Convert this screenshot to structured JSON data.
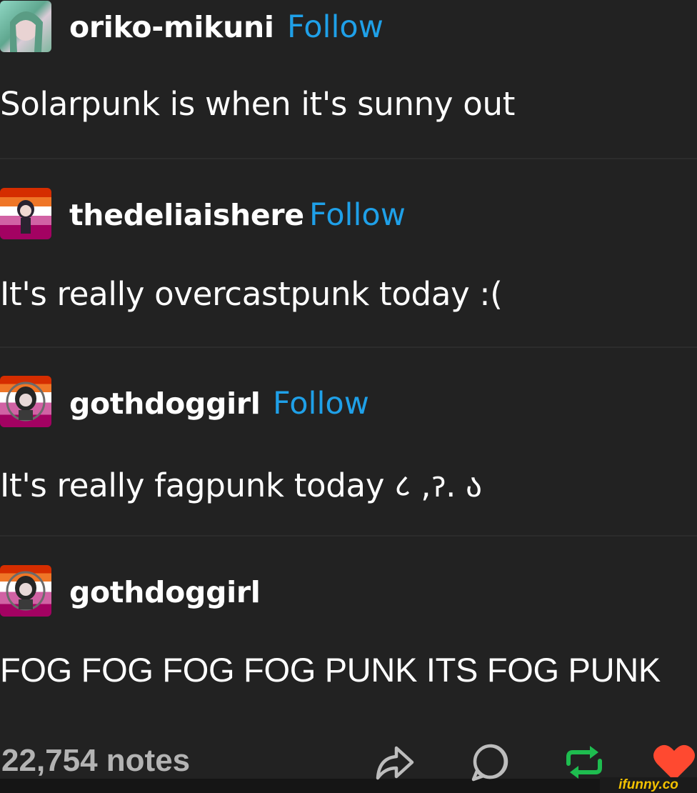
{
  "posts": [
    {
      "username": "oriko-mikuni",
      "follow": "Follow",
      "text": "Solarpunk is when it's sunny out"
    },
    {
      "username": "thedeliaishere",
      "follow": "Follow",
      "text": "It's really overcastpunk today :("
    },
    {
      "username": "gothdoggirl",
      "follow": "Follow",
      "text": "It's really fagpunk today ८ ,ॽ. ა"
    },
    {
      "username": "gothdoggirl",
      "follow": "",
      "text": "FOG FOG FOG FOG PUNK ITS FOG PUNK"
    }
  ],
  "footer": {
    "notes": "22,754 notes"
  },
  "actions": [
    "share-icon",
    "reply-icon",
    "reblog-icon",
    "like-icon"
  ],
  "colors": {
    "follow": "#1fa0e8",
    "reblog": "#1ebc4f",
    "like": "#ff4930",
    "background": "#222222"
  },
  "watermark": "ifunny.co"
}
